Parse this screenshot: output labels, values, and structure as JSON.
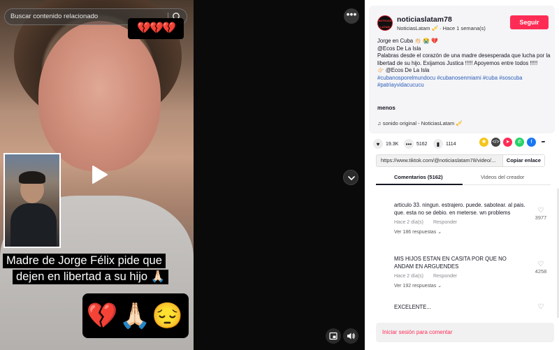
{
  "video": {
    "search_placeholder": "Buscar contenido relacionado",
    "hearts_badge": "💔💔💔",
    "caption_line_1": "Madre de Jorge Félix pide que",
    "caption_line_2": "dejen en libertad a su hijo 🙏🏻",
    "emoji_badge": "💔🙏🏻😔",
    "more_label": "•••"
  },
  "post": {
    "avatar_text": "NOTICIAS LATAM",
    "username": "noticiaslatam78",
    "display_name": "NoticiasLatam 🎺",
    "time": "Hace 1 semana(s)",
    "follow_label": "Seguir",
    "desc_line_1": "Jorge en Cuba 👏🏻 😭 💔",
    "desc_line_2": "@Ecos De La Isla",
    "desc_body": "Palabras desde el corazón de una madre desesperada que lucha por la libertad de su hijo. Exijamos Justica !!!!! Apoyemos entre todos !!!!!",
    "desc_line_mention": "👉🏻 @Ecos De La Isla",
    "hashtags": "#cubanosporelmundocu #cubanosenmiami #cuba #soscuba #patriayvidacucucu",
    "less_label": "menos",
    "sound": "sonido original - NoticiasLatam 🎺"
  },
  "stats": {
    "likes": "19.3K",
    "comments": "5162",
    "saves": "1114"
  },
  "share": {
    "link": "https://www.tiktok.com/@noticiaslatam78/video/...",
    "copy_label": "Copiar enlace"
  },
  "tabs": {
    "comments": "Comentarios (5162)",
    "creator": "Videos del creador"
  },
  "comments": [
    {
      "text": "articulo 33. ningun. estrajero. puede. sabotear. al pais. que. esta no se debio. en meterse. wn problems",
      "time": "Hace 2 día(s)",
      "reply": "Responder",
      "replies": "Ver 186 respuestas",
      "likes": "3977"
    },
    {
      "text": "MIS HIJOS ESTAN EN CASITA POR QUE NO ANDAM EN ARGUENDES",
      "time": "Hace 2 día(s)",
      "reply": "Responder",
      "replies": "Ver 192 respuestas",
      "likes": "4258"
    },
    {
      "text": "EXCELENTE...",
      "time": "Hace 2 día(s)",
      "reply": "Responder",
      "replies": "",
      "likes": ""
    }
  ],
  "login_prompt": "Iniciar sesión para comentar",
  "colors": {
    "accent": "#fe2c55",
    "hashtag": "#2b5db9"
  }
}
